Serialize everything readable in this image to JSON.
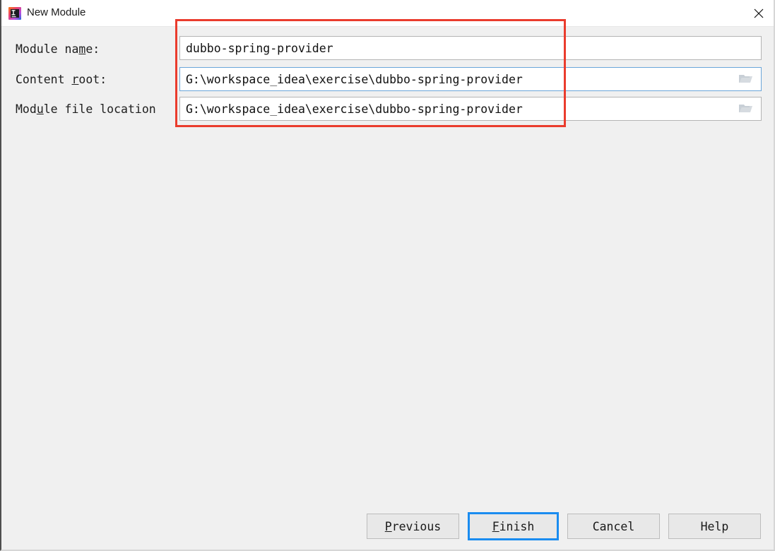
{
  "window": {
    "title": "New Module",
    "app_icon": "intellij-idea-icon",
    "close_icon": "close-icon",
    "background": "#f0f0f0",
    "titlebar_background": "#ffffff"
  },
  "annotation": {
    "type": "red-rectangle-highlight",
    "color": "#ea3c2d"
  },
  "form": {
    "rows": [
      {
        "label_before": "Module na",
        "label_mnemonic": "m",
        "label_after": "e:",
        "value": "dubbo-spring-provider",
        "placeholder": "",
        "focused": false,
        "has_browse_button": false,
        "browse_icon": "folder-icon"
      },
      {
        "label_before": "Content ",
        "label_mnemonic": "r",
        "label_after": "oot:",
        "value": "G:\\workspace_idea\\exercise\\dubbo-spring-provider",
        "placeholder": "",
        "focused": true,
        "has_browse_button": true,
        "browse_icon": "folder-icon"
      },
      {
        "label_before": "Mod",
        "label_mnemonic": "u",
        "label_after": "le file location",
        "value": "G:\\workspace_idea\\exercise\\dubbo-spring-provider",
        "placeholder": "",
        "focused": false,
        "has_browse_button": true,
        "browse_icon": "folder-icon"
      }
    ]
  },
  "footer": {
    "buttons": [
      {
        "label_before": "",
        "label_mnemonic": "P",
        "label_after": "revious",
        "default": false
      },
      {
        "label_before": "",
        "label_mnemonic": "F",
        "label_after": "inish",
        "default": true
      },
      {
        "label_before": "Cancel",
        "label_mnemonic": "",
        "label_after": "",
        "default": false
      },
      {
        "label_before": "Help",
        "label_mnemonic": "",
        "label_after": "",
        "default": false
      }
    ]
  }
}
